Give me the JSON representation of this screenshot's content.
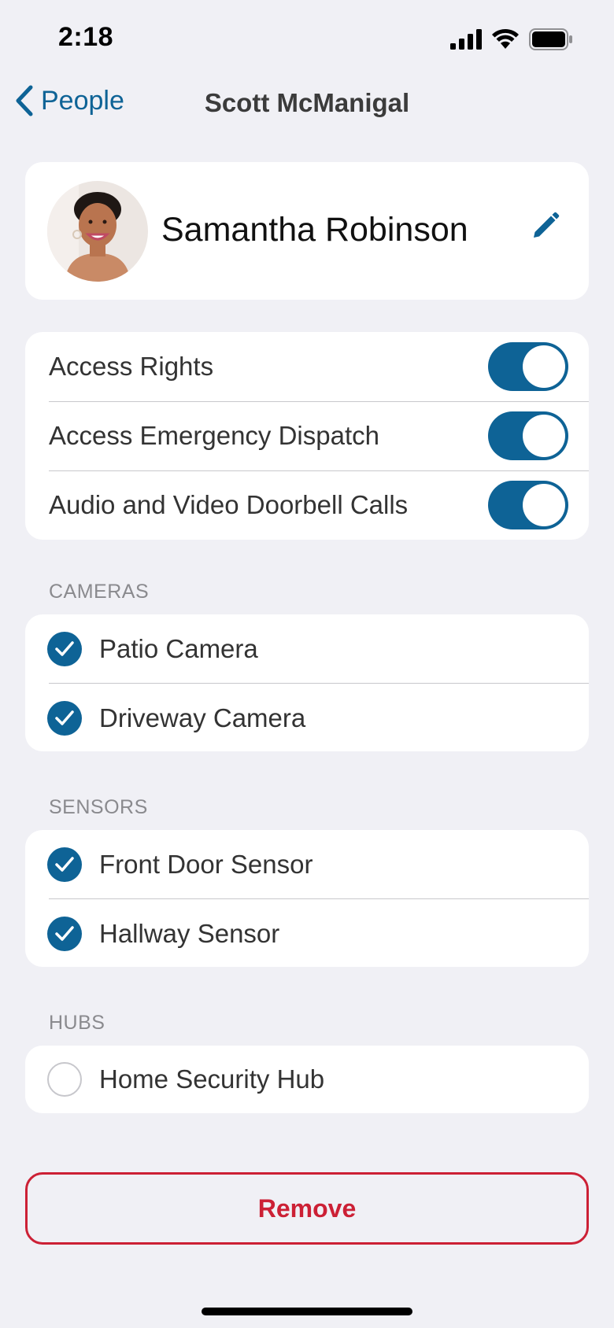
{
  "status_bar": {
    "time": "2:18"
  },
  "nav": {
    "back_label": "People",
    "title": "Scott McManigal"
  },
  "profile": {
    "name": "Samantha Robinson"
  },
  "permissions": [
    {
      "label": "Access Rights",
      "enabled": true
    },
    {
      "label": "Access Emergency Dispatch",
      "enabled": true
    },
    {
      "label": "Audio and Video Doorbell Calls",
      "enabled": true
    }
  ],
  "cameras": {
    "header": "CAMERAS",
    "items": [
      {
        "label": "Patio Camera",
        "checked": true
      },
      {
        "label": "Driveway Camera",
        "checked": true
      }
    ]
  },
  "sensors": {
    "header": "SENSORS",
    "items": [
      {
        "label": "Front Door Sensor",
        "checked": true
      },
      {
        "label": "Hallway Sensor",
        "checked": true
      }
    ]
  },
  "hubs": {
    "header": "HUBS",
    "items": [
      {
        "label": "Home Security Hub",
        "checked": false
      }
    ]
  },
  "actions": {
    "remove_label": "Remove"
  },
  "colors": {
    "accent": "#0e6396",
    "destructive": "#cc2035",
    "background": "#f0f0f5"
  }
}
